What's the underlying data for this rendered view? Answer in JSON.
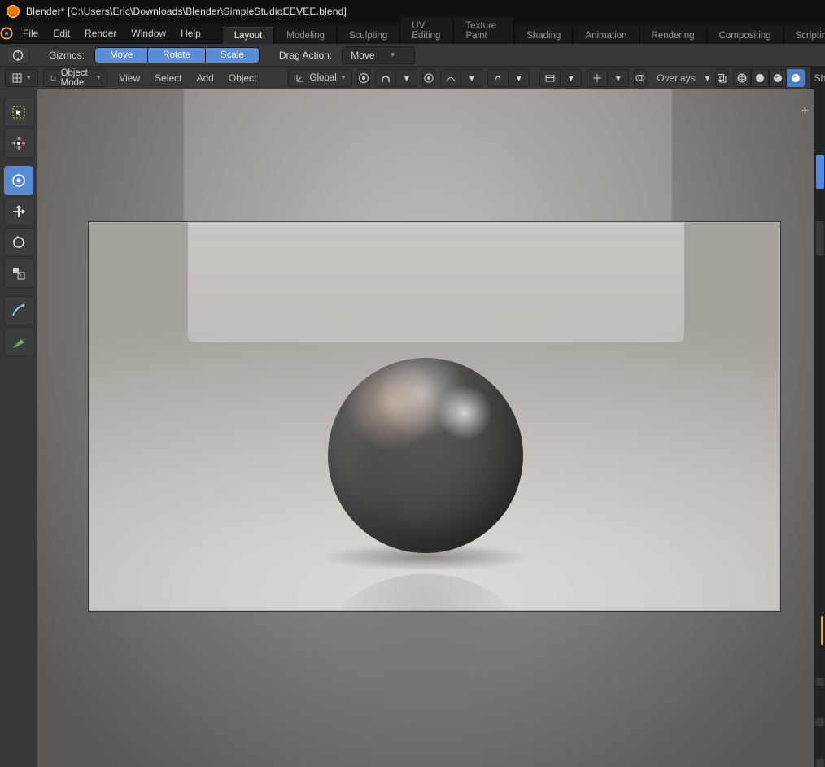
{
  "window": {
    "title": "Blender* [C:\\Users\\Eric\\Downloads\\Blender\\SimpleStudioEEVEE.blend]"
  },
  "menubar": {
    "items": [
      "File",
      "Edit",
      "Render",
      "Window",
      "Help"
    ]
  },
  "workspace_tabs": {
    "active_index": 0,
    "tabs": [
      "Layout",
      "Modeling",
      "Sculpting",
      "UV Editing",
      "Texture Paint",
      "Shading",
      "Animation",
      "Rendering",
      "Compositing",
      "Scripting"
    ],
    "add_label": "+"
  },
  "gizmo_bar": {
    "label": "Gizmos:",
    "buttons": [
      "Move",
      "Rotate",
      "Scale"
    ],
    "drag_label": "Drag Action:",
    "drag_value": "Move"
  },
  "viewport_header": {
    "mode": "Object Mode",
    "menus": [
      "View",
      "Select",
      "Add",
      "Object"
    ],
    "orientation": "Global",
    "overlays_label": "Overlays",
    "shading_label": "Shading"
  },
  "tool_shelf": {
    "tools": [
      "select-box-tool",
      "cursor-tool",
      "move-tool",
      "rotate-tool",
      "scale-tool",
      "transform-tool",
      "annotate-tool",
      "measure-tool"
    ],
    "active_index": 2
  }
}
